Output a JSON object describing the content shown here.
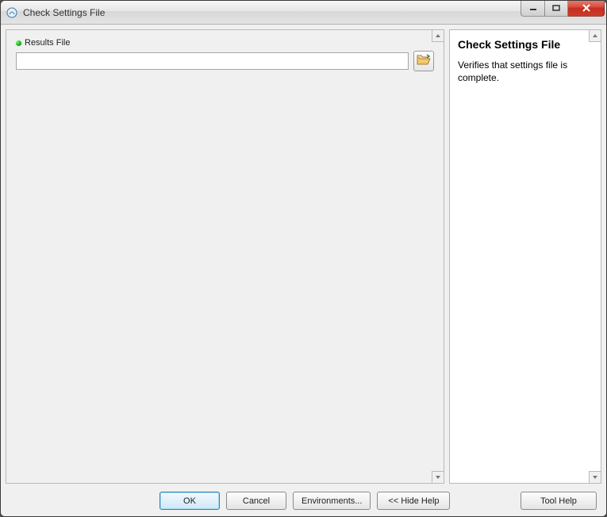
{
  "window": {
    "title": "Check Settings File"
  },
  "main": {
    "fields": {
      "results_file": {
        "label": "Results File",
        "value": ""
      }
    }
  },
  "help": {
    "title": "Check Settings File",
    "body": "Verifies that settings file is complete."
  },
  "buttons": {
    "ok": "OK",
    "cancel": "Cancel",
    "environments": "Environments...",
    "hide_help": "<< Hide Help",
    "tool_help": "Tool Help"
  }
}
